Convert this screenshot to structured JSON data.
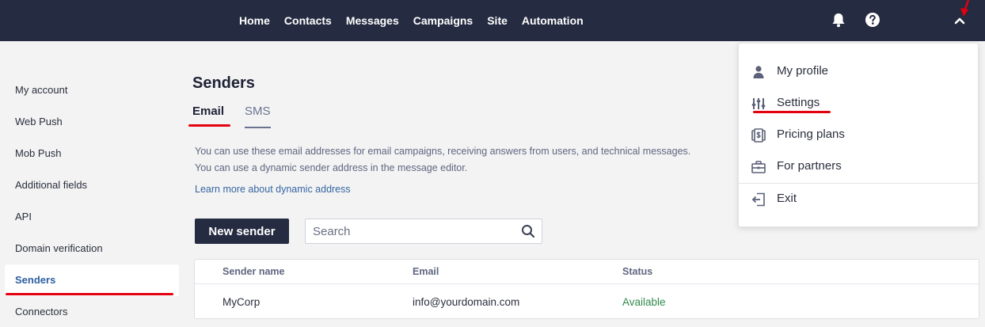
{
  "topnav": {
    "items": [
      "Home",
      "Contacts",
      "Messages",
      "Campaigns",
      "Site",
      "Automation"
    ]
  },
  "sidebar": {
    "items": [
      {
        "label": "My account"
      },
      {
        "label": "Web Push"
      },
      {
        "label": "Mob Push"
      },
      {
        "label": "Additional fields"
      },
      {
        "label": "API"
      },
      {
        "label": "Domain verification"
      },
      {
        "label": "Senders",
        "active": true
      },
      {
        "label": "Connectors"
      }
    ]
  },
  "main": {
    "title": "Senders",
    "tabs": [
      {
        "label": "Email",
        "active": true
      },
      {
        "label": "SMS",
        "active": false
      }
    ],
    "info_line1": "You can use these email addresses for email campaigns, receiving answers from users, and technical messages.",
    "info_line2": "You can use a dynamic sender address in the message editor.",
    "learn_more": "Learn more about dynamic address",
    "new_sender_label": "New sender",
    "search_placeholder": "Search",
    "table": {
      "headers": [
        "Sender name",
        "Email",
        "Status"
      ],
      "rows": [
        {
          "name": "MyCorp",
          "email": "info@yourdomain.com",
          "status": "Available"
        }
      ]
    }
  },
  "dropdown": {
    "items": [
      {
        "label": "My profile",
        "icon": "person-icon"
      },
      {
        "label": "Settings",
        "icon": "sliders-icon"
      },
      {
        "label": "Pricing plans",
        "icon": "money-icon"
      },
      {
        "label": "For partners",
        "icon": "briefcase-icon"
      },
      {
        "label": "Exit",
        "icon": "exit-icon"
      }
    ]
  },
  "colors": {
    "topbar": "#252b41",
    "annotation": "#e3000f",
    "link": "#3566a3",
    "status_available": "#2f8a4a"
  }
}
